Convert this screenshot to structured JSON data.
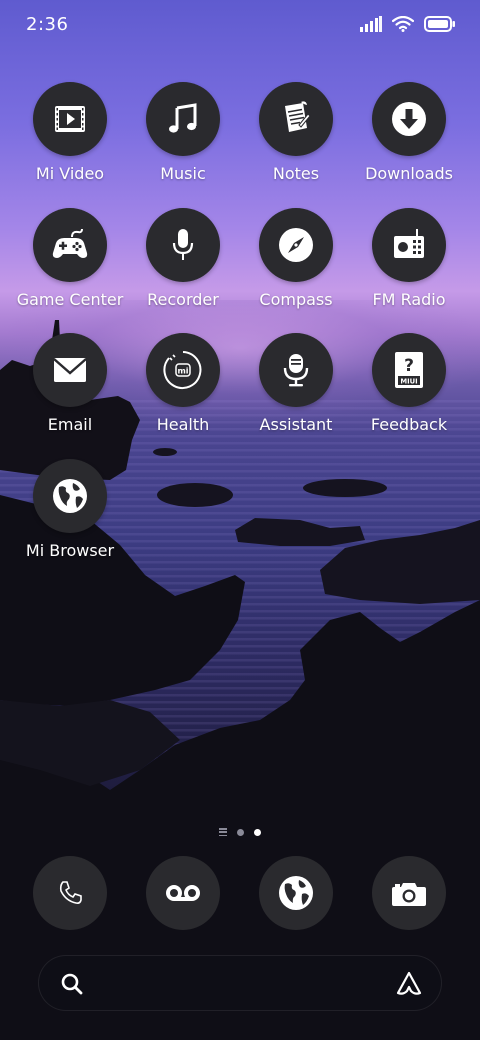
{
  "status_bar": {
    "time": "2:36",
    "signal_icon": "cellular-signal-icon",
    "wifi_icon": "wifi-icon",
    "battery_icon": "battery-icon"
  },
  "apps": [
    {
      "label": "Mi Video",
      "icon": "play-video-icon"
    },
    {
      "label": "Music",
      "icon": "music-note-icon"
    },
    {
      "label": "Notes",
      "icon": "notes-paper-icon"
    },
    {
      "label": "Downloads",
      "icon": "download-arrow-icon"
    },
    {
      "label": "Game Center",
      "icon": "gamepad-icon"
    },
    {
      "label": "Recorder",
      "icon": "microphone-icon"
    },
    {
      "label": "Compass",
      "icon": "compass-icon"
    },
    {
      "label": "FM Radio",
      "icon": "radio-icon"
    },
    {
      "label": "Email",
      "icon": "envelope-icon"
    },
    {
      "label": "Health",
      "icon": "mi-health-icon"
    },
    {
      "label": "Assistant",
      "icon": "studio-mic-icon"
    },
    {
      "label": "Feedback",
      "icon": "miui-feedback-icon",
      "icon_text": "MIUI"
    },
    {
      "label": "Mi Browser",
      "icon": "globe-icon"
    }
  ],
  "health_icon_text": "mi",
  "page_indicator": {
    "pages": 2,
    "active_page": 2
  },
  "dock": [
    {
      "name": "phone",
      "icon": "phone-handset-icon"
    },
    {
      "name": "voicemail",
      "icon": "voicemail-icon"
    },
    {
      "name": "browser",
      "icon": "globe-icon"
    },
    {
      "name": "camera",
      "icon": "camera-icon"
    }
  ],
  "search_bar": {
    "search_icon": "search-icon",
    "assistant_icon": "assistant-logo-icon"
  },
  "colors": {
    "icon_background": "#2a2a2e",
    "icon_glyph": "#ffffff",
    "label": "#ffffff"
  }
}
